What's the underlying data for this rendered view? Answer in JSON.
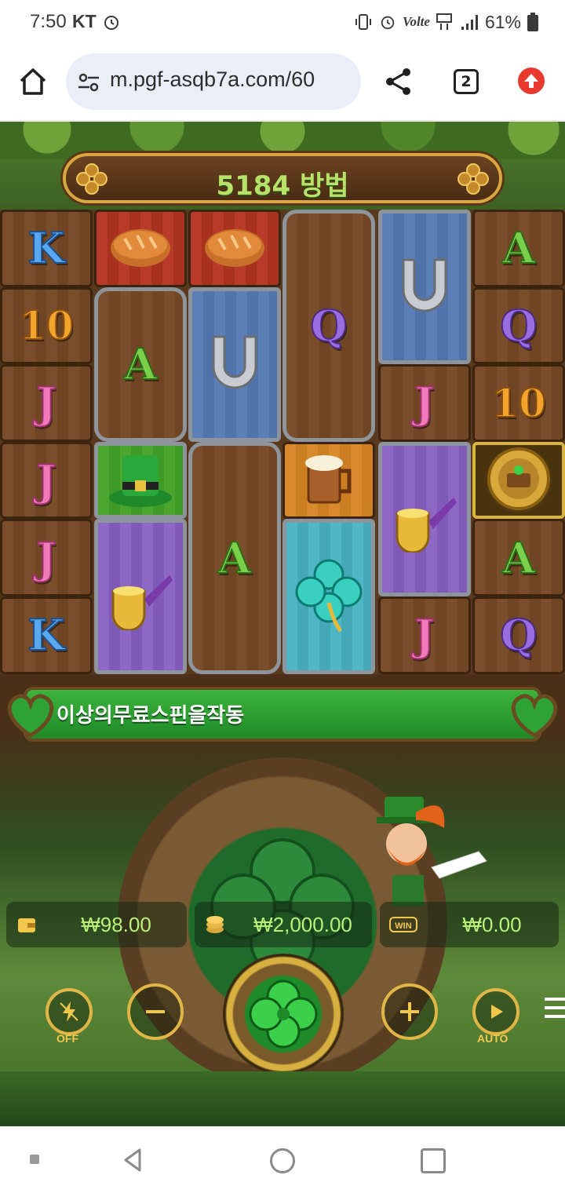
{
  "status_bar": {
    "time": "7:50",
    "carrier": "KT",
    "volte": "Volte",
    "battery_percent": "61%"
  },
  "browser": {
    "url": "m.pgf-asqb7a.com/60",
    "tab_count": "2"
  },
  "game": {
    "ways_text": "5184 방법",
    "message": "3 이상의 무료 스핀을 작동",
    "message_visible": "이상의무료스핀을작동",
    "reels": [
      [
        {
          "symbol": "K",
          "type": "k",
          "rows": 1
        },
        {
          "symbol": "10",
          "type": "ten",
          "rows": 1
        },
        {
          "symbol": "J",
          "type": "j",
          "rows": 1
        },
        {
          "symbol": "J",
          "type": "j",
          "rows": 1
        },
        {
          "symbol": "J",
          "type": "j",
          "rows": 1
        },
        {
          "symbol": "K",
          "type": "k",
          "rows": 1
        }
      ],
      [
        {
          "symbol": "bread",
          "type": "bread",
          "rows": 1
        },
        {
          "symbol": "A",
          "type": "a",
          "rows": 2
        },
        {
          "symbol": "hat",
          "type": "hat",
          "rows": 1
        },
        {
          "symbol": "pipe",
          "type": "pipe",
          "rows": 2
        }
      ],
      [
        {
          "symbol": "bread",
          "type": "bread",
          "rows": 1
        },
        {
          "symbol": "horseshoe",
          "type": "horseshoe",
          "rows": 2
        },
        {
          "symbol": "A",
          "type": "a",
          "rows": 3
        }
      ],
      [
        {
          "symbol": "Q",
          "type": "q",
          "rows": 3
        },
        {
          "symbol": "beer",
          "type": "beer",
          "rows": 1
        },
        {
          "symbol": "clover",
          "type": "clover",
          "rows": 2
        }
      ],
      [
        {
          "symbol": "horseshoe",
          "type": "horseshoe",
          "rows": 2
        },
        {
          "symbol": "J",
          "type": "j",
          "rows": 1
        },
        {
          "symbol": "pipe",
          "type": "pipe",
          "rows": 2
        },
        {
          "symbol": "J",
          "type": "j",
          "rows": 1
        }
      ],
      [
        {
          "symbol": "A",
          "type": "a",
          "rows": 1
        },
        {
          "symbol": "Q",
          "type": "q",
          "rows": 1
        },
        {
          "symbol": "10",
          "type": "ten",
          "rows": 1
        },
        {
          "symbol": "scatter",
          "type": "scatter",
          "rows": 1
        },
        {
          "symbol": "A",
          "type": "a",
          "rows": 1
        },
        {
          "symbol": "Q",
          "type": "q",
          "rows": 1
        }
      ]
    ],
    "balance": {
      "wallet": "₩98.00",
      "bet": "₩2,000.00",
      "win": "₩0.00",
      "win_icon_label": "WIN"
    },
    "controls": {
      "turbo_label": "OFF",
      "auto_label": "AUTO"
    }
  },
  "icons": {
    "home": "home-icon",
    "site_settings": "tune-icon",
    "share": "share-icon",
    "update": "arrow-up-icon",
    "menu": "hamburger-icon"
  },
  "colors": {
    "balance_text": "#b8f07a",
    "gold_accent": "#e2b646",
    "ways_text": "#b6e26a",
    "message_bar": "#2fa236"
  }
}
